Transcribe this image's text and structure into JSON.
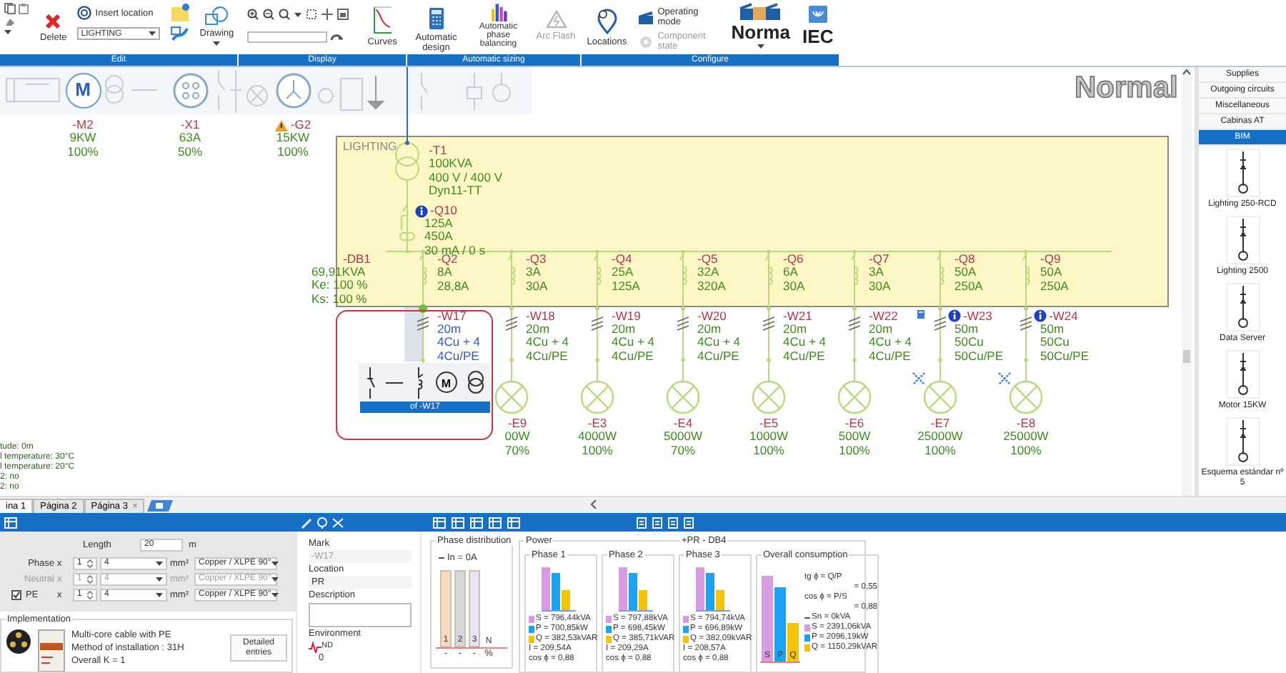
{
  "ribbon": {
    "groups": [
      {
        "label": "Edit",
        "tools": [
          {
            "kind": "clipboard",
            "disabled": false
          },
          {
            "kind": "delete",
            "label": "Delete",
            "disabled": false
          },
          {
            "kind": "location",
            "label": "Insert location",
            "value": "LIGHTING",
            "disabled": false
          },
          {
            "kind": "notes",
            "disabled": false
          },
          {
            "kind": "drawing",
            "label": "Drawing",
            "disabled": false
          }
        ]
      },
      {
        "label": "Display",
        "tools": [
          {
            "kind": "zoom",
            "disabled": false
          },
          {
            "kind": "curves",
            "label": "Curves",
            "disabled": false
          }
        ]
      },
      {
        "label": "Automatic sizing",
        "tools": [
          {
            "kind": "calculator",
            "label": "Automatic design",
            "disabled": false
          },
          {
            "kind": "phases",
            "label": "Automatic phase balancing",
            "disabled": false
          },
          {
            "kind": "arc",
            "label": "Arc Flash",
            "disabled": true
          }
        ]
      },
      {
        "label": "Configure",
        "tools": [
          {
            "kind": "locations",
            "label": "Locations",
            "disabled": false
          },
          {
            "kind": "modes",
            "disabled": false,
            "items": [
              {
                "label": "Operating mode",
                "disabled": false
              },
              {
                "label": "Component state",
                "disabled": true
              }
            ]
          },
          {
            "kind": "norma",
            "label": "Norma",
            "disabled": false
          },
          {
            "kind": "iec",
            "label": "IEC",
            "disabled": false
          }
        ]
      }
    ]
  },
  "diagram": {
    "palette": [
      {
        "kind": "motor",
        "symbol": "M",
        "ref": "-M2",
        "rating": "9KW",
        "load": "100%",
        "warning": false
      },
      {
        "kind": "socket",
        "ref": "-X1",
        "rating": "63A",
        "load": "50%",
        "warning": false
      },
      {
        "kind": "generator",
        "ref": "-G2",
        "rating": "15KW",
        "load": "100%",
        "warning": true
      }
    ],
    "mode": "Normal",
    "board": {
      "name": "LIGHTING",
      "ref": "-DB1",
      "summary": [
        "69,91KVA",
        "Ke: 100 %",
        "Ks: 100 %"
      ],
      "transformer": {
        "ref": "-T1",
        "lines": [
          "100KVA",
          "400 V / 400 V",
          "Dyn11-TT"
        ]
      },
      "main_breaker": {
        "ref": "-Q10",
        "info": true,
        "lines": [
          "125A",
          "450A",
          "30 mA / 0 s"
        ]
      }
    },
    "circuits": [
      {
        "breaker": {
          "ref": "-Q2",
          "lines": [
            "8A",
            "28,8A"
          ]
        },
        "cable": {
          "ref": "-W17",
          "lines": [
            "20m",
            "4Cu + 4",
            "4Cu/PE"
          ]
        },
        "selected": true,
        "info": false,
        "tagged": false,
        "crossed": false,
        "popup": {
          "symbol": "M",
          "caption": "of -W17"
        }
      },
      {
        "breaker": {
          "ref": "-Q3",
          "lines": [
            "3A",
            "30A"
          ]
        },
        "cable": {
          "ref": "-W18",
          "lines": [
            "20m",
            "4Cu + 4",
            "4Cu/PE"
          ]
        },
        "selected": false,
        "info": false,
        "tagged": false,
        "crossed": false,
        "load": {
          "ref": "-E9",
          "lines": [
            "00W",
            "70%"
          ]
        }
      },
      {
        "breaker": {
          "ref": "-Q4",
          "lines": [
            "25A",
            "125A"
          ]
        },
        "cable": {
          "ref": "-W19",
          "lines": [
            "20m",
            "4Cu + 4",
            "4Cu/PE"
          ]
        },
        "selected": false,
        "info": false,
        "tagged": false,
        "crossed": false,
        "load": {
          "ref": "-E3",
          "lines": [
            "4000W",
            "100%"
          ]
        }
      },
      {
        "breaker": {
          "ref": "-Q5",
          "lines": [
            "32A",
            "320A"
          ]
        },
        "cable": {
          "ref": "-W20",
          "lines": [
            "20m",
            "4Cu + 4",
            "4Cu/PE"
          ]
        },
        "selected": false,
        "info": false,
        "tagged": false,
        "crossed": false,
        "load": {
          "ref": "-E4",
          "lines": [
            "5000W",
            "70%"
          ]
        }
      },
      {
        "breaker": {
          "ref": "-Q6",
          "lines": [
            "6A",
            "30A"
          ]
        },
        "cable": {
          "ref": "-W21",
          "lines": [
            "20m",
            "4Cu + 4",
            "4Cu/PE"
          ]
        },
        "selected": false,
        "info": false,
        "tagged": false,
        "crossed": false,
        "load": {
          "ref": "-E5",
          "lines": [
            "1000W",
            "100%"
          ]
        }
      },
      {
        "breaker": {
          "ref": "-Q7",
          "lines": [
            "3A",
            "30A"
          ]
        },
        "cable": {
          "ref": "-W22",
          "lines": [
            "20m",
            "4Cu + 4",
            "4Cu/PE"
          ]
        },
        "selected": false,
        "info": false,
        "tagged": false,
        "crossed": false,
        "load": {
          "ref": "-E6",
          "lines": [
            "500W",
            "100%"
          ]
        }
      },
      {
        "breaker": {
          "ref": "-Q8",
          "lines": [
            "50A",
            "250A"
          ]
        },
        "cable": {
          "ref": "-W23",
          "lines": [
            "50m",
            "50Cu",
            "50Cu/PE"
          ]
        },
        "selected": false,
        "info": true,
        "tagged": true,
        "crossed": true,
        "load": {
          "ref": "-E7",
          "lines": [
            "25000W",
            "100%"
          ]
        }
      },
      {
        "breaker": {
          "ref": "-Q9",
          "lines": [
            "50A",
            "250A"
          ]
        },
        "cable": {
          "ref": "-W24",
          "lines": [
            "50m",
            "50Cu",
            "50Cu/PE"
          ]
        },
        "selected": false,
        "info": true,
        "tagged": false,
        "crossed": true,
        "load": {
          "ref": "-E8",
          "lines": [
            "25000W",
            "100%"
          ]
        }
      }
    ],
    "site_info": [
      "tude: 0m",
      "l temperature: 30°C",
      "l temperature: 20°C",
      "2: no",
      "2: no"
    ]
  },
  "library": {
    "categories": [
      {
        "label": "Supplies",
        "selected": false
      },
      {
        "label": "Outgoing circuits",
        "selected": false
      },
      {
        "label": "Miscellaneous",
        "selected": false
      },
      {
        "label": "Cabinas AT",
        "selected": false
      },
      {
        "label": "BIM",
        "selected": true
      }
    ],
    "items": [
      "Lighting 250-RCD",
      "Lighting 2500",
      "Data Server",
      "Motor 15KW",
      "Esquema estándar nº 5"
    ]
  },
  "page_tabs": [
    {
      "label": "ina 1",
      "selected": true
    },
    {
      "label": "Página 2",
      "selected": false
    },
    {
      "label": "Página 3",
      "selected": false,
      "close": "×"
    }
  ],
  "cable_panel": {
    "length": {
      "label": "Length",
      "value": "20",
      "unit": "m"
    },
    "conductors": [
      {
        "kind": "plain",
        "label": "Phase",
        "times": "x",
        "count": "1",
        "section": "4",
        "unit": "mm²",
        "material": "Copper / XLPE 90°",
        "disabled": false
      },
      {
        "kind": "plain",
        "label": "Neutral",
        "times": "x",
        "count": "1",
        "section": "4",
        "unit": "mm²",
        "material": "Copper / XLPE 90°",
        "disabled": true
      },
      {
        "kind": "check",
        "label": "PE",
        "checked": true,
        "times": "x",
        "count": "1",
        "section": "4",
        "unit": "mm²",
        "material": "Copper / XLPE 90°",
        "disabled": false
      }
    ],
    "implementation": {
      "title": "Implementation",
      "lines": [
        "Multi-core cable with PE",
        "Method of installation : 31H",
        "Overall K = 1"
      ],
      "button": "Detailed entries"
    }
  },
  "properties": {
    "mark": {
      "label": "Mark",
      "value": "-W17"
    },
    "location": {
      "label": "Location",
      "value": "PR"
    },
    "description": {
      "label": "Description"
    },
    "environment": {
      "label": "Environment",
      "badge": "ND",
      "value": "0"
    }
  },
  "power": {
    "distribution": {
      "title": "Phase distribution",
      "legend": "In = 0A",
      "bars": [
        {
          "label": "1",
          "color": "#fbd9bf"
        },
        {
          "label": "2",
          "color": "#d6d6d6"
        },
        {
          "label": "3",
          "color": "#e9e4fa"
        },
        {
          "label": "N"
        }
      ],
      "footer": [
        "-",
        "-",
        "-",
        "%"
      ]
    },
    "title": "Power",
    "location": "+PR - DB4",
    "phases": [
      {
        "title": "Phase 1",
        "lines": [
          {
            "text": "S = 796,44kVA",
            "color": "#d79be0"
          },
          {
            "text": "P = 700,85kW",
            "color": "#1da1f2"
          },
          {
            "text": "Q = 382,53kVAR",
            "color": "#f5c400"
          },
          {
            "text": "I = 209,54A"
          },
          {
            "text": "cos ϕ = 0,88"
          }
        ]
      },
      {
        "title": "Phase 2",
        "lines": [
          {
            "text": "S = 797,88kVA",
            "color": "#d79be0"
          },
          {
            "text": "P = 698,45kW",
            "color": "#1da1f2"
          },
          {
            "text": "Q = 385,71kVAR",
            "color": "#f5c400"
          },
          {
            "text": "I = 209,29A"
          },
          {
            "text": "cos ϕ = 0,88"
          }
        ]
      },
      {
        "title": "Phase 3",
        "lines": [
          {
            "text": "S = 794,74kVA",
            "color": "#d79be0"
          },
          {
            "text": "P = 696,89kW",
            "color": "#1da1f2"
          },
          {
            "text": "Q = 382,09kVAR",
            "color": "#f5c400"
          },
          {
            "text": "I = 208,57A"
          },
          {
            "text": "cos ϕ = 0,88"
          }
        ]
      }
    ],
    "overall": {
      "title": "Overall consumption",
      "bars": [
        {
          "label": "S",
          "color": "#d79be0"
        },
        {
          "label": "P",
          "color": "#1da1f2"
        },
        {
          "label": "Q",
          "color": "#f5c400"
        }
      ],
      "ratios": [
        "tg ϕ = Q/P",
        "= 0,55",
        "cos ϕ = P/S",
        "= 0,88"
      ],
      "nominal": "Sn = 0kVA",
      "lines": [
        {
          "text": "S = 2391,06kVA",
          "color": "#d79be0"
        },
        {
          "text": "P = 2096,19kW",
          "color": "#1da1f2"
        },
        {
          "text": "Q = 1150,29kVAR",
          "color": "#f5c400"
        }
      ]
    }
  }
}
